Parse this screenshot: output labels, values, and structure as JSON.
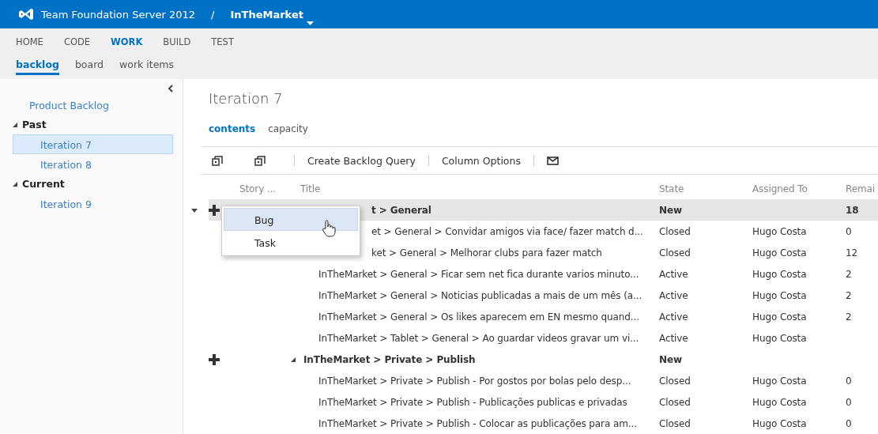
{
  "header": {
    "product": "Team Foundation Server 2012",
    "separator": "/",
    "project": "InTheMarket"
  },
  "nav": {
    "tabs": [
      {
        "label": "HOME",
        "selected": false
      },
      {
        "label": "CODE",
        "selected": false
      },
      {
        "label": "WORK",
        "selected": true
      },
      {
        "label": "BUILD",
        "selected": false
      },
      {
        "label": "TEST",
        "selected": false
      }
    ],
    "subtabs": [
      {
        "label": "backlog",
        "selected": true
      },
      {
        "label": "board",
        "selected": false
      },
      {
        "label": "work items",
        "selected": false
      }
    ]
  },
  "sidebar": {
    "items": [
      {
        "label": "Product Backlog",
        "selected": false
      },
      {
        "label": "Past",
        "expanded": true,
        "children": [
          {
            "label": "Iteration 7",
            "selected": true
          },
          {
            "label": "Iteration 8",
            "selected": false
          }
        ]
      },
      {
        "label": "Current",
        "expanded": true,
        "children": [
          {
            "label": "Iteration 9",
            "selected": false
          }
        ]
      }
    ]
  },
  "page_title": "Iteration 7",
  "view_tabs": [
    {
      "label": "contents",
      "selected": true
    },
    {
      "label": "capacity",
      "selected": false
    }
  ],
  "toolbar": {
    "buttons": [
      "Create Backlog Query",
      "Column Options"
    ]
  },
  "table": {
    "columns": [
      "Story ...",
      "Title",
      "State",
      "Assigned To",
      "Remai"
    ],
    "rows": [
      {
        "kind": "parent",
        "expanded": true,
        "selected": true,
        "covered": true,
        "title": "t > General",
        "state": "New",
        "assigned_to": "",
        "remaining": "18"
      },
      {
        "kind": "child",
        "selected": false,
        "covered": true,
        "title": "et > General > Convidar amigos via face/ fazer match d...",
        "state": "Closed",
        "assigned_to": "Hugo Costa",
        "remaining": "0"
      },
      {
        "kind": "child",
        "selected": false,
        "covered": true,
        "title": "ket > General > Melhorar clubs para fazer match",
        "state": "Closed",
        "assigned_to": "Hugo Costa",
        "remaining": "12"
      },
      {
        "kind": "child",
        "selected": false,
        "covered": false,
        "title": "InTheMarket > General > Ficar sem net fica durante varios minuto...",
        "state": "Active",
        "assigned_to": "Hugo Costa",
        "remaining": "2"
      },
      {
        "kind": "child",
        "selected": false,
        "covered": false,
        "title": "InTheMarket > General > Noticias publicadas a mais de um mês (a...",
        "state": "Active",
        "assigned_to": "Hugo Costa",
        "remaining": "2"
      },
      {
        "kind": "child",
        "selected": false,
        "covered": false,
        "title": "InTheMarket > General > Os likes aparecem em EN mesmo quand...",
        "state": "Active",
        "assigned_to": "Hugo Costa",
        "remaining": "2"
      },
      {
        "kind": "child",
        "selected": false,
        "covered": false,
        "title": "InTheMarket > Tablet > General > Ao guardar videos gravar um vi...",
        "state": "Active",
        "assigned_to": "Hugo Costa",
        "remaining": ""
      },
      {
        "kind": "parent",
        "expanded": true,
        "selected": false,
        "covered": false,
        "title": "InTheMarket > Private > Publish",
        "state": "New",
        "assigned_to": "",
        "remaining": ""
      },
      {
        "kind": "child",
        "selected": false,
        "covered": false,
        "title": "InTheMarket > Private > Publish - Por gostos por bolas pelo desp...",
        "state": "Closed",
        "assigned_to": "Hugo Costa",
        "remaining": "0"
      },
      {
        "kind": "child",
        "selected": false,
        "covered": false,
        "title": "InTheMarket > Private > Publish - Publicações publicas e privadas",
        "state": "Closed",
        "assigned_to": "Hugo Costa",
        "remaining": "0"
      },
      {
        "kind": "child",
        "selected": false,
        "covered": false,
        "title": "InTheMarket > Private > Publish - Colocar as publicações para am...",
        "state": "Closed",
        "assigned_to": "Hugo Costa",
        "remaining": "0"
      }
    ]
  },
  "add_menu": {
    "items": [
      {
        "label": "Bug",
        "selected": true
      },
      {
        "label": "Task",
        "selected": false
      }
    ]
  }
}
